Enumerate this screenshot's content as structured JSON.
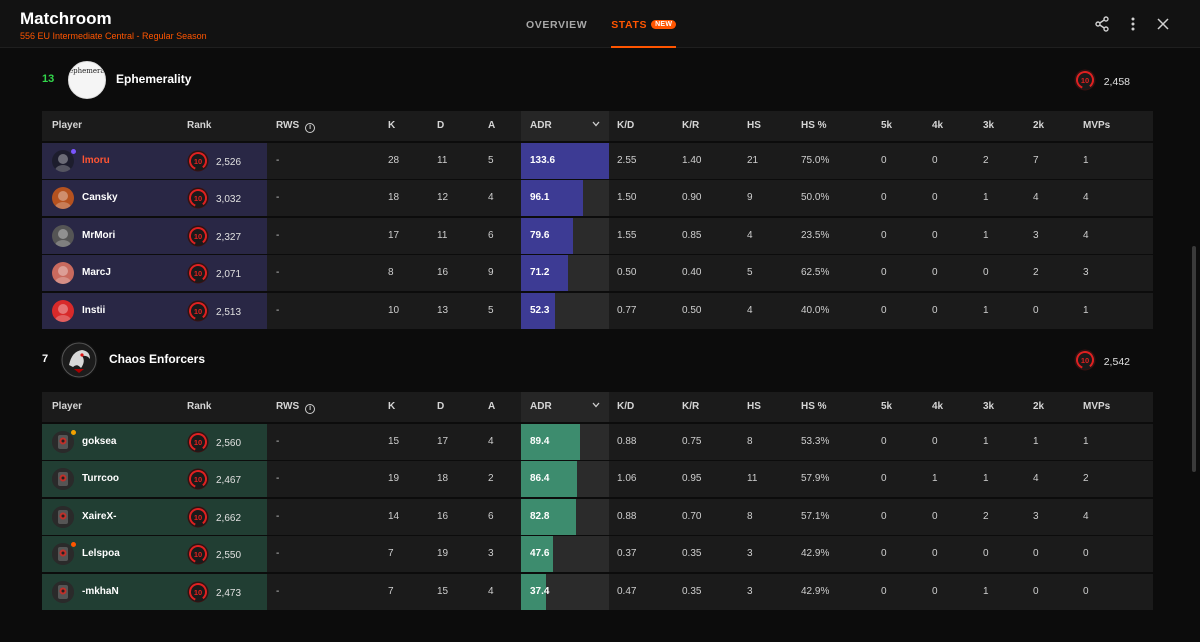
{
  "header": {
    "title": "Matchroom",
    "subtitle": "556 EU Intermediate Central - Regular Season",
    "tabs": [
      {
        "label": "OVERVIEW",
        "active": false
      },
      {
        "label": "STATS",
        "active": true,
        "badge": "NEW"
      }
    ],
    "icons": [
      "share-icon",
      "more-vertical-icon",
      "close-icon"
    ]
  },
  "columns": [
    "Player",
    "Rank",
    "RWS",
    "K",
    "D",
    "A",
    "ADR",
    "K/D",
    "K/R",
    "HS",
    "HS %",
    "5k",
    "4k",
    "3k",
    "2k",
    "MVPs"
  ],
  "colors": {
    "accent": "#ff5500",
    "team1_row": "#292745",
    "team1_adr": "#3d3b94",
    "team2_row": "#213e33",
    "team2_adr": "#3d8c6e",
    "rank_badge": "#e02020"
  },
  "teams": [
    {
      "position": "13",
      "position_color": "#32d74b",
      "name": "Ephemerality",
      "logo_text": "ephemerality",
      "level": "10",
      "elo": "2,458",
      "players": [
        {
          "name": "lmoru",
          "highlight": true,
          "level": "10",
          "elo": "2,526",
          "rws": "-",
          "k": "28",
          "d": "11",
          "a": "5",
          "adr": "133.6",
          "adr_pct": 100,
          "kd": "2.55",
          "kr": "1.40",
          "hs": "21",
          "hs_pct": "75.0%",
          "k5": "0",
          "k4": "0",
          "k3": "2",
          "k2": "7",
          "mvps": "1",
          "avatar_color": "#1d1d2d",
          "status": "#7a55ff"
        },
        {
          "name": "Cansky",
          "highlight": false,
          "level": "10",
          "elo": "3,032",
          "rws": "-",
          "k": "18",
          "d": "12",
          "a": "4",
          "adr": "96.1",
          "adr_pct": 71,
          "kd": "1.50",
          "kr": "0.90",
          "hs": "9",
          "hs_pct": "50.0%",
          "k5": "0",
          "k4": "0",
          "k3": "1",
          "k2": "4",
          "mvps": "4",
          "avatar_color": "#b5521f"
        },
        {
          "name": "MrMori",
          "highlight": false,
          "level": "10",
          "elo": "2,327",
          "rws": "-",
          "k": "17",
          "d": "11",
          "a": "6",
          "adr": "79.6",
          "adr_pct": 59,
          "kd": "1.55",
          "kr": "0.85",
          "hs": "4",
          "hs_pct": "23.5%",
          "k5": "0",
          "k4": "0",
          "k3": "1",
          "k2": "3",
          "mvps": "4",
          "avatar_color": "#555555"
        },
        {
          "name": "MarcJ",
          "highlight": false,
          "level": "10",
          "elo": "2,071",
          "rws": "-",
          "k": "8",
          "d": "16",
          "a": "9",
          "adr": "71.2",
          "adr_pct": 53,
          "kd": "0.50",
          "kr": "0.40",
          "hs": "5",
          "hs_pct": "62.5%",
          "k5": "0",
          "k4": "0",
          "k3": "0",
          "k2": "2",
          "mvps": "3",
          "avatar_color": "#c96a5e"
        },
        {
          "name": "Instii",
          "highlight": false,
          "level": "10",
          "elo": "2,513",
          "rws": "-",
          "k": "10",
          "d": "13",
          "a": "5",
          "adr": "52.3",
          "adr_pct": 39,
          "kd": "0.77",
          "kr": "0.50",
          "hs": "4",
          "hs_pct": "40.0%",
          "k5": "0",
          "k4": "0",
          "k3": "1",
          "k2": "0",
          "mvps": "1",
          "avatar_color": "#d82a2a"
        }
      ]
    },
    {
      "position": "7",
      "position_color": "#ffffff",
      "name": "Chaos Enforcers",
      "level": "10",
      "elo": "2,542",
      "players": [
        {
          "name": "goksea",
          "highlight": false,
          "level": "10",
          "elo": "2,560",
          "rws": "-",
          "k": "15",
          "d": "17",
          "a": "4",
          "adr": "89.4",
          "adr_pct": 67,
          "kd": "0.88",
          "kr": "0.75",
          "hs": "8",
          "hs_pct": "53.3%",
          "k5": "0",
          "k4": "0",
          "k3": "1",
          "k2": "1",
          "mvps": "1",
          "avatar_color": "#2a2a2a",
          "status": "#f2a100"
        },
        {
          "name": "Turrcoo",
          "highlight": false,
          "level": "10",
          "elo": "2,467",
          "rws": "-",
          "k": "19",
          "d": "18",
          "a": "2",
          "adr": "86.4",
          "adr_pct": 64,
          "kd": "1.06",
          "kr": "0.95",
          "hs": "11",
          "hs_pct": "57.9%",
          "k5": "0",
          "k4": "1",
          "k3": "1",
          "k2": "4",
          "mvps": "2",
          "avatar_color": "#2a2a2a"
        },
        {
          "name": "XaireX-",
          "highlight": false,
          "level": "10",
          "elo": "2,662",
          "rws": "-",
          "k": "14",
          "d": "16",
          "a": "6",
          "adr": "82.8",
          "adr_pct": 62,
          "kd": "0.88",
          "kr": "0.70",
          "hs": "8",
          "hs_pct": "57.1%",
          "k5": "0",
          "k4": "0",
          "k3": "2",
          "k2": "3",
          "mvps": "4",
          "avatar_color": "#2a2a2a"
        },
        {
          "name": "Lelspoa",
          "highlight": false,
          "level": "10",
          "elo": "2,550",
          "rws": "-",
          "k": "7",
          "d": "19",
          "a": "3",
          "adr": "47.6",
          "adr_pct": 36,
          "kd": "0.37",
          "kr": "0.35",
          "hs": "3",
          "hs_pct": "42.9%",
          "k5": "0",
          "k4": "0",
          "k3": "0",
          "k2": "0",
          "mvps": "0",
          "avatar_color": "#2a2a2a",
          "status": "#ff5500"
        },
        {
          "name": "-mkhaN",
          "highlight": false,
          "level": "10",
          "elo": "2,473",
          "rws": "-",
          "k": "7",
          "d": "15",
          "a": "4",
          "adr": "37.4",
          "adr_pct": 28,
          "kd": "0.47",
          "kr": "0.35",
          "hs": "3",
          "hs_pct": "42.9%",
          "k5": "0",
          "k4": "0",
          "k3": "1",
          "k2": "0",
          "mvps": "0",
          "avatar_color": "#2a2a2a"
        }
      ]
    }
  ]
}
